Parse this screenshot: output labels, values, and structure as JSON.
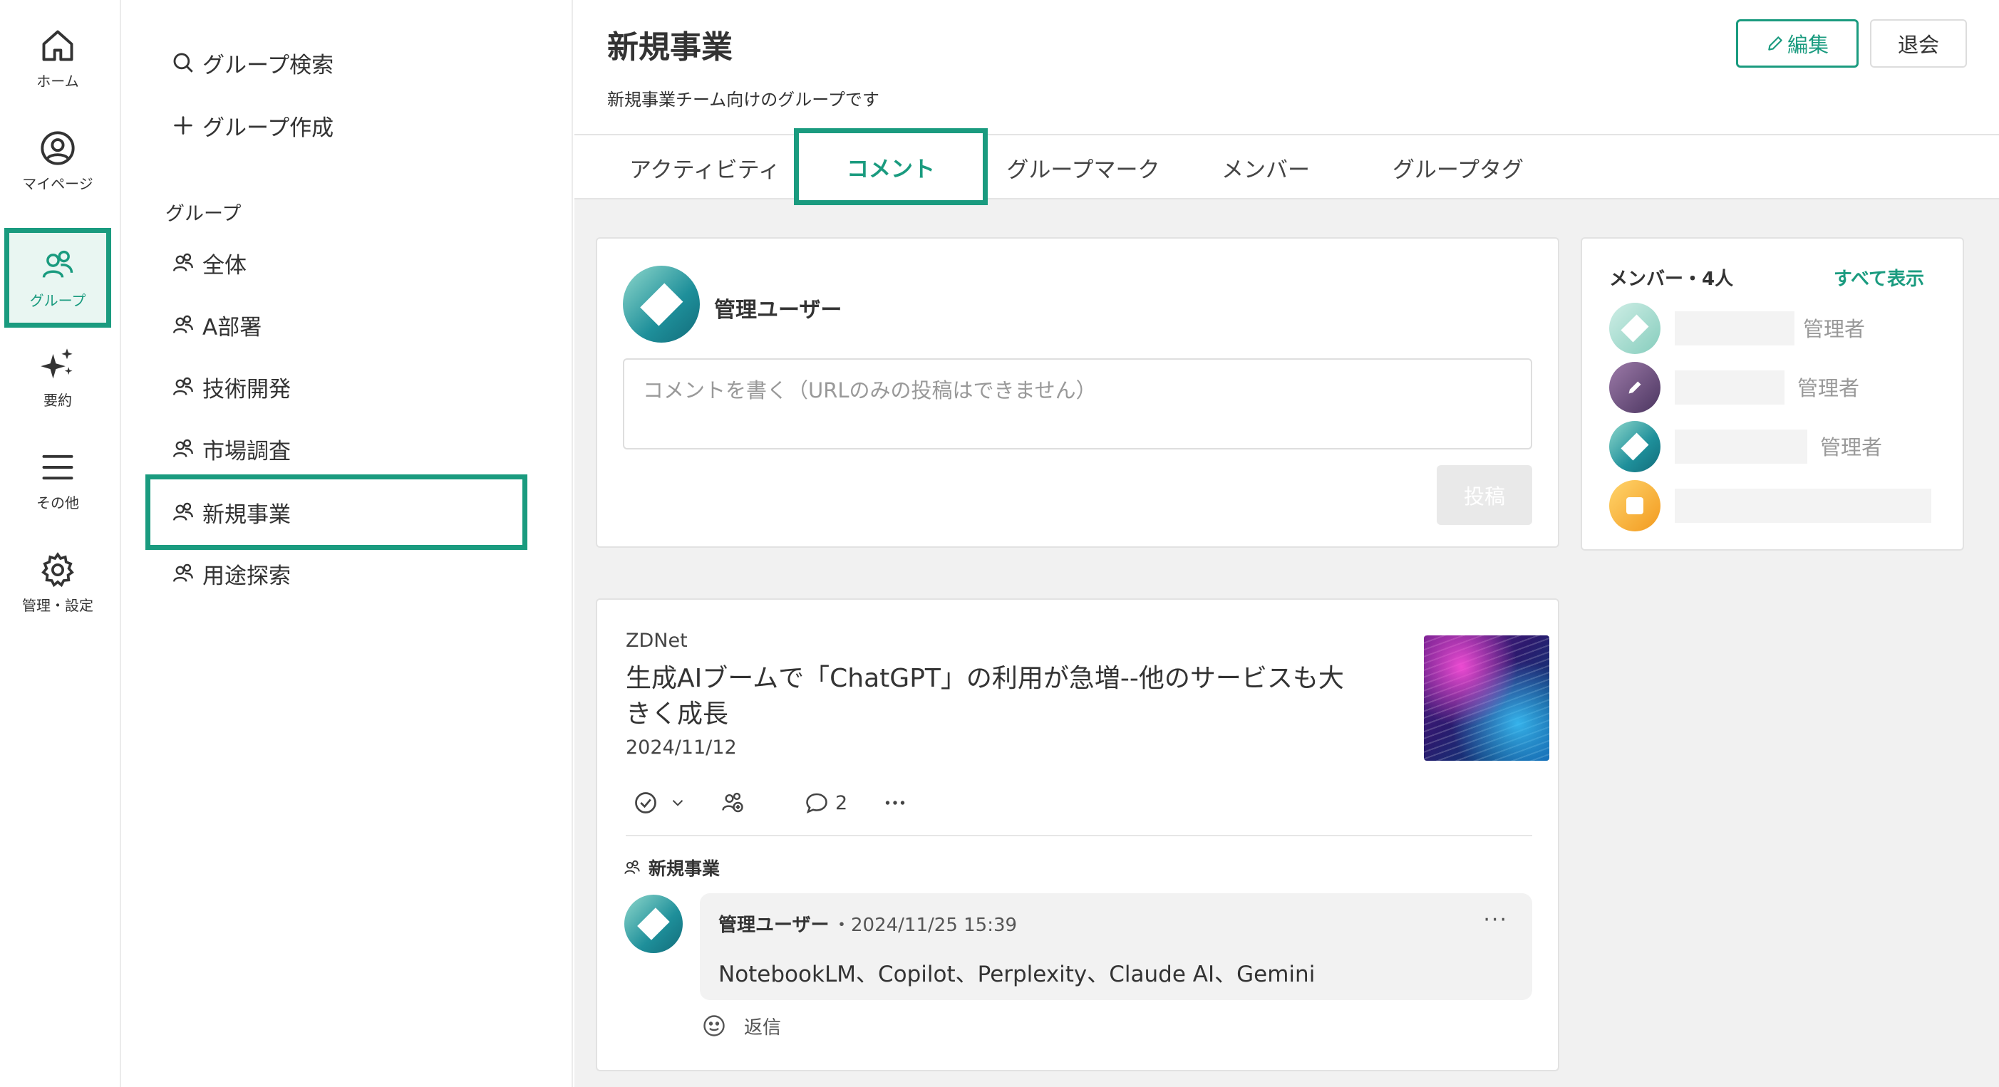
{
  "rail": {
    "items": [
      {
        "label": "ホーム",
        "icon": "home-icon"
      },
      {
        "label": "マイページ",
        "icon": "user-circle-icon"
      },
      {
        "label": "グループ",
        "icon": "group-icon"
      },
      {
        "label": "要約",
        "icon": "sparkle-icon"
      },
      {
        "label": "その他",
        "icon": "menu-icon"
      },
      {
        "label": "管理・設定",
        "icon": "gear-icon"
      }
    ]
  },
  "sidebar": {
    "search_label": "グループ検索",
    "create_label": "グループ作成",
    "heading": "グループ",
    "items": [
      {
        "label": "全体"
      },
      {
        "label": "A部署"
      },
      {
        "label": "技術開発"
      },
      {
        "label": "市場調査"
      },
      {
        "label": "新規事業"
      },
      {
        "label": "用途探索"
      }
    ]
  },
  "header": {
    "title": "新規事業",
    "description": "新規事業チーム向けのグループです",
    "edit_label": "編集",
    "leave_label": "退会"
  },
  "tabs": [
    {
      "label": "アクティビティ"
    },
    {
      "label": "コメント"
    },
    {
      "label": "グループマーク"
    },
    {
      "label": "メンバー"
    },
    {
      "label": "グループタグ"
    }
  ],
  "composer": {
    "user": "管理ユーザー",
    "placeholder": "コメントを書く（URLのみの投稿はできません）",
    "post_label": "投稿"
  },
  "members": {
    "title": "メンバー・4人",
    "show_all": "すべて表示",
    "list": [
      {
        "role": "管理者"
      },
      {
        "role": "管理者"
      },
      {
        "role": "管理者"
      },
      {
        "role": ""
      }
    ]
  },
  "article": {
    "source": "ZDNet",
    "headline": "生成AIブームで「ChatGPT」の利用が急増--他のサービスも大きく成長",
    "date": "2024/11/12",
    "comment_count": "2",
    "group": "新規事業",
    "comment": {
      "user": "管理ユーザー",
      "time": "・2024/11/25 15:39",
      "text": "NotebookLM、Copilot、Perplexity、Claude AI、Gemini",
      "more": "···",
      "reply_label": "返信"
    }
  },
  "colors": {
    "accent": "#1a9b7f",
    "background": "#f1f1f1"
  }
}
